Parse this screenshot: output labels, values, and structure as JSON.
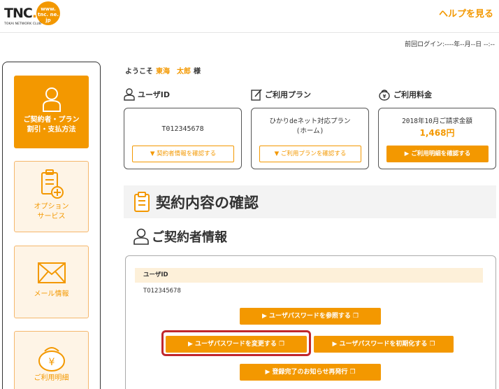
{
  "header": {
    "logo_text": "TNC",
    "logo_dot": ".",
    "logo_sub": "TOKAI NETWORK CLUB",
    "logo_url": "www. tnc. ne. jp",
    "help_label": "ヘルプを見る",
    "last_login": "前回ログイン:----年--月--日 --:--"
  },
  "sidebar": {
    "items": [
      {
        "label1": "ご契約者・プラン",
        "label2": "割引・支払方法",
        "icon": "person-icon",
        "active": true
      },
      {
        "label1": "オプション",
        "label2": "サービス",
        "icon": "clipboard-plus-icon",
        "active": false
      },
      {
        "label1": "メール情報",
        "label2": "",
        "icon": "envelope-icon",
        "active": false
      },
      {
        "label1": "ご利用明細",
        "label2": "",
        "icon": "yen-purse-icon",
        "active": false
      }
    ]
  },
  "welcome": {
    "prefix": "ようこそ",
    "name": "東海　太郎",
    "suffix": "様"
  },
  "summary": {
    "user_id": {
      "heading": "ユーザID",
      "value": "T012345678",
      "button": "▼ 契約者情報を確認する"
    },
    "plan": {
      "heading": "ご利用プラン",
      "line1": "ひかりdeネット対応プラン",
      "line2": "(ホーム)",
      "button": "▼ ご利用プランを確認する"
    },
    "fee": {
      "heading": "ご利用料金",
      "line1": "2018年10月ご請求金額",
      "amount": "1,468円",
      "button": "▶ ご利用明細を確認する"
    }
  },
  "section": {
    "title": "契約内容の確認",
    "subtitle": "ご契約者情報"
  },
  "details": {
    "uid_label": "ユーザID",
    "uid_value": "T012345678",
    "buttons": {
      "view_password": "▶ ユーザパスワードを参照する ❐",
      "change_password": "▶ ユーザパスワードを変更する ❐",
      "reset_password": "▶ ユーザパスワードを初期化する ❐",
      "reissue_notice": "▶ 登録完了のお知らせ再発行 ❐"
    }
  },
  "colors": {
    "accent": "#f39800",
    "highlight": "#c0272d"
  }
}
